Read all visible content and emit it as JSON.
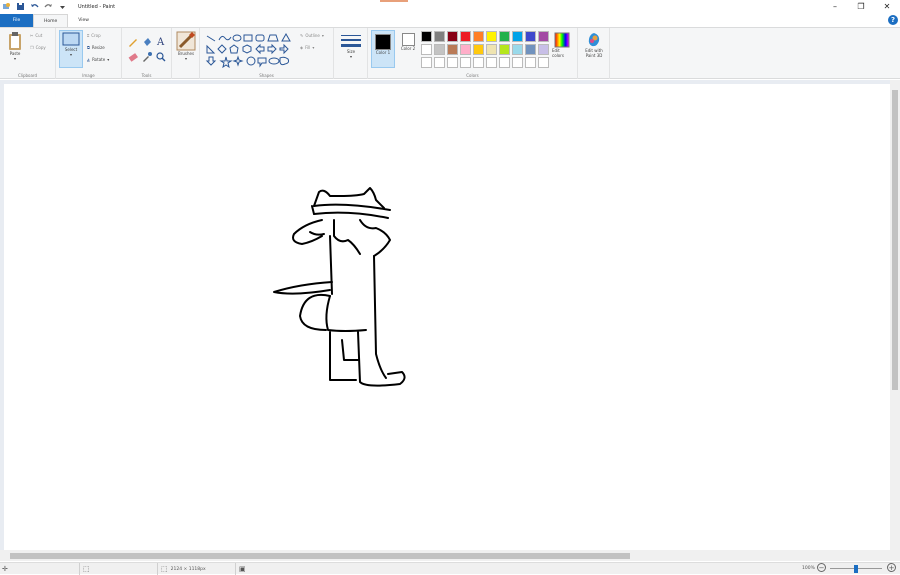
{
  "window": {
    "title": "Untitled - Paint"
  },
  "quick_access": {
    "icons": [
      "paint-app-icon",
      "save-icon",
      "undo-icon",
      "redo-icon",
      "customize-icon"
    ]
  },
  "window_controls": {
    "minimize": "–",
    "restore": "❐",
    "close": "✕"
  },
  "tabs": [
    {
      "label": "File"
    },
    {
      "label": "Home"
    },
    {
      "label": "View"
    }
  ],
  "help": {
    "label": "?"
  },
  "ribbon": {
    "clipboard": {
      "label": "Clipboard",
      "paste": "Paste",
      "cut": "Cut",
      "copy": "Copy"
    },
    "image": {
      "label": "Image",
      "select": "Select",
      "crop": "Crop",
      "resize": "Resize",
      "rotate": "Rotate"
    },
    "tools": {
      "label": "Tools"
    },
    "brushes": {
      "label": "Brushes"
    },
    "shapes": {
      "label": "Shapes",
      "outline": "Outline",
      "fill": "Fill"
    },
    "size": {
      "label": "Size"
    },
    "colors": {
      "label": "Colors",
      "color1": "Color 1",
      "color2": "Color 2",
      "edit_colors": "Edit colors",
      "edit_paint3d": "Edit with Paint 3D",
      "palette_row1": [
        "#000000",
        "#7f7f7f",
        "#880015",
        "#ed1c24",
        "#ff7f27",
        "#fff200",
        "#22b14c",
        "#00a2e8",
        "#3f48cc",
        "#a349a4"
      ],
      "palette_row2": [
        "#ffffff",
        "#c3c3c3",
        "#b97a57",
        "#ffaec9",
        "#ffc90e",
        "#efe4b0",
        "#b5e61d",
        "#99d9ea",
        "#7092be",
        "#c8bfe7"
      ]
    }
  },
  "status": {
    "dimensions": "2124 × 1118px",
    "zoom": "100%"
  }
}
